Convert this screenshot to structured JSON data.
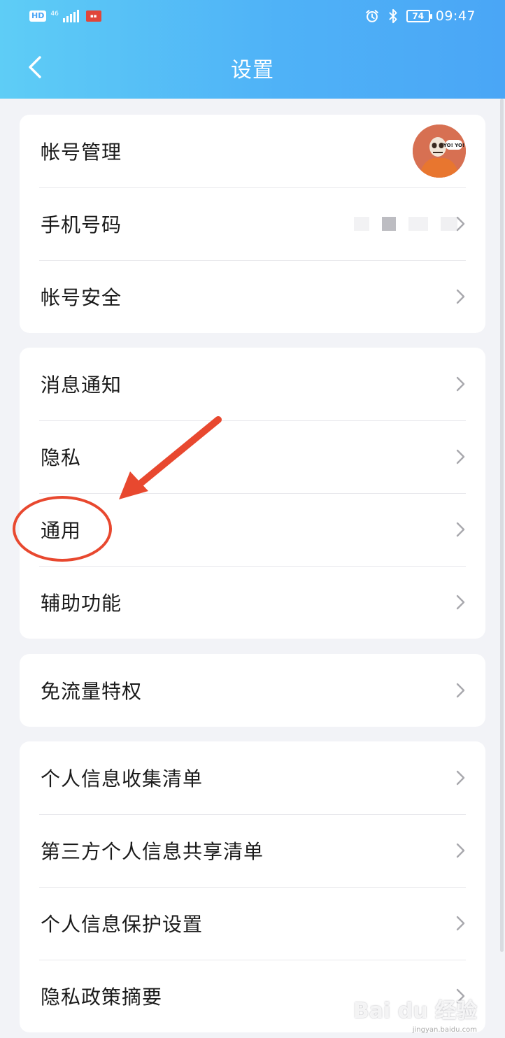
{
  "status_bar": {
    "hd": "HD",
    "network": "46",
    "battery": "74",
    "time": "09:47"
  },
  "header": {
    "title": "设置"
  },
  "groups": [
    {
      "items": [
        {
          "label": "帐号管理",
          "trailing": "avatar",
          "avatar_text": "YO! YO!"
        },
        {
          "label": "手机号码",
          "trailing": "masked"
        },
        {
          "label": "帐号安全",
          "trailing": "chevron"
        }
      ]
    },
    {
      "items": [
        {
          "label": "消息通知",
          "trailing": "chevron"
        },
        {
          "label": "隐私",
          "trailing": "chevron"
        },
        {
          "label": "通用",
          "trailing": "chevron",
          "highlighted": true
        },
        {
          "label": "辅助功能",
          "trailing": "chevron"
        }
      ]
    },
    {
      "items": [
        {
          "label": "免流量特权",
          "trailing": "chevron"
        }
      ]
    },
    {
      "items": [
        {
          "label": "个人信息收集清单",
          "trailing": "chevron"
        },
        {
          "label": "第三方个人信息共享清单",
          "trailing": "chevron"
        },
        {
          "label": "个人信息保护设置",
          "trailing": "chevron"
        },
        {
          "label": "隐私政策摘要",
          "trailing": "chevron"
        }
      ]
    }
  ],
  "annotation": {
    "color": "#e8482f"
  },
  "watermark": {
    "brand": "Bai du 经验",
    "url": "jingyan.baidu.com"
  },
  "colors": {
    "header_start": "#5ecdf6",
    "header_end": "#4aa6f6",
    "background": "#f2f3f7",
    "card": "#ffffff"
  }
}
